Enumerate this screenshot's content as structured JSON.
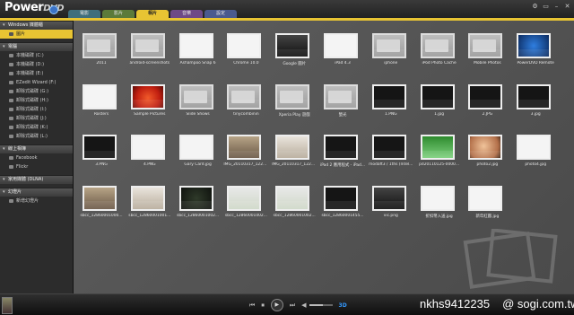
{
  "app": {
    "logo": "Power",
    "logo_suffix": "DVD"
  },
  "tabs": [
    {
      "label": "電影"
    },
    {
      "label": "影片"
    },
    {
      "label": "相片"
    },
    {
      "label": "音樂"
    },
    {
      "label": "設定"
    }
  ],
  "active_tab_index": 2,
  "window_controls": [
    "⚙",
    "▭",
    "–",
    "✕"
  ],
  "sidebar": {
    "sections": [
      {
        "label": "Windows 媒體櫃",
        "items": [
          {
            "label": "圖片",
            "selected": true
          }
        ]
      },
      {
        "label": "電腦",
        "items": [
          {
            "label": "本機磁碟 (C:)"
          },
          {
            "label": "本機磁碟 (D:)"
          },
          {
            "label": "本機磁碟 (E:)"
          },
          {
            "label": "EZedit Wizard (F:)"
          },
          {
            "label": "卸除式磁碟 (G:)"
          },
          {
            "label": "卸除式磁碟 (H:)"
          },
          {
            "label": "卸除式磁碟 (I:)"
          },
          {
            "label": "卸除式磁碟 (J:)"
          },
          {
            "label": "卸除式磁碟 (K:)"
          },
          {
            "label": "卸除式磁碟 (L:)"
          }
        ]
      },
      {
        "label": "線上相簿",
        "items": [
          {
            "label": "Facebook"
          },
          {
            "label": "Flickr"
          }
        ]
      },
      {
        "label": "家用媒體 (DLNA)",
        "items": []
      },
      {
        "label": "幻燈片",
        "items": [
          {
            "label": "新增幻燈片"
          }
        ]
      }
    ]
  },
  "grid_items": [
    {
      "caption": "2011",
      "kind": "folder"
    },
    {
      "caption": "android-screenshots",
      "kind": "folder"
    },
    {
      "caption": "Ashampoo Snap 6",
      "kind": "shot"
    },
    {
      "caption": "Chrome 10.0",
      "kind": "shot"
    },
    {
      "caption": "Google 圖片",
      "kind": "cam"
    },
    {
      "caption": "iPad 4.3",
      "kind": "shot"
    },
    {
      "caption": "iphone",
      "kind": "folder"
    },
    {
      "caption": "iPod Photo Cache",
      "kind": "folder"
    },
    {
      "caption": "Mobile Photos",
      "kind": "folder"
    },
    {
      "caption": "PowerDVD Remote",
      "kind": "phone"
    },
    {
      "caption": "Rosters",
      "kind": "shot"
    },
    {
      "caption": "Sample Pictures",
      "kind": "photo-red"
    },
    {
      "caption": "Slide Shows",
      "kind": "folder"
    },
    {
      "caption": "tinycombinin",
      "kind": "folder"
    },
    {
      "caption": "Xperia Play 遊戲",
      "kind": "folder"
    },
    {
      "caption": "螢光",
      "kind": "folder"
    },
    {
      "caption": "1.PNG",
      "kind": "dark"
    },
    {
      "caption": "1.jpg",
      "kind": "dark"
    },
    {
      "caption": "2.JPG",
      "kind": "dark"
    },
    {
      "caption": "3.jpg",
      "kind": "dark"
    },
    {
      "caption": "3.PNG",
      "kind": "dark"
    },
    {
      "caption": "4.PNG",
      "kind": "shot"
    },
    {
      "caption": "Gary Card.jpg",
      "kind": "shot"
    },
    {
      "caption": "IMG_20110317_1221...",
      "kind": "photo-warm"
    },
    {
      "caption": "IMG_20110317_1221...",
      "kind": "cake"
    },
    {
      "caption": "iPad 2 應用程式 - iPad...",
      "kind": "dark"
    },
    {
      "caption": "modaft3 / 1ths (Intel...",
      "kind": "dark"
    },
    {
      "caption": "pd20110125-0000...",
      "kind": "green-card"
    },
    {
      "caption": "photo2.jpg",
      "kind": "face"
    },
    {
      "caption": "photo4.jpg",
      "kind": "shot"
    },
    {
      "caption": "sbcc_12860001000...",
      "kind": "photo-warm"
    },
    {
      "caption": "sbcc_12860001001...",
      "kind": "cake"
    },
    {
      "caption": "sbcc_12860001002...",
      "kind": "photo-dark"
    },
    {
      "caption": "sbcc_12860001002...",
      "kind": "photo-green"
    },
    {
      "caption": "sbcc_12860001002...",
      "kind": "photo-green"
    },
    {
      "caption": "sbcc_12860001455...",
      "kind": "dark"
    },
    {
      "caption": "vic.png",
      "kind": "cam"
    },
    {
      "caption": "折扣幣入送.jpg",
      "kind": "shot"
    },
    {
      "caption": "新年紅圖.jpg",
      "kind": "shot"
    }
  ],
  "player": {
    "controls": [
      "⏮",
      "⏹",
      "▶",
      "⏭"
    ],
    "volume_fraction": 0.6,
    "hd_label": "3D"
  },
  "credit": {
    "user": "nkhs9412235",
    "site": "@ sogi.com.tw"
  }
}
